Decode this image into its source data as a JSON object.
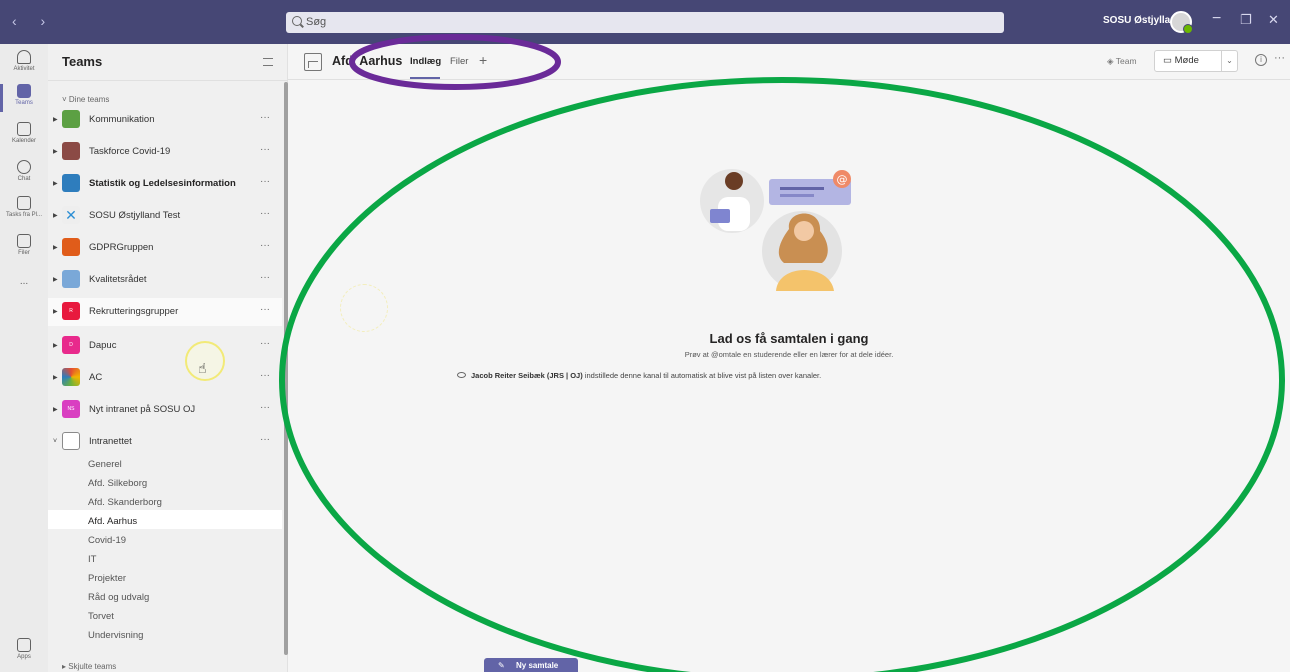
{
  "titlebar": {
    "nav": "‹  ›",
    "search_placeholder": "Søg",
    "org_name": "SOSU Østjylland",
    "minimize": "−",
    "maximize": "❐",
    "close": "✕"
  },
  "rail": [
    {
      "label": "Aktivitet",
      "icon": "bell-icon"
    },
    {
      "label": "Teams",
      "icon": "teams-icon"
    },
    {
      "label": "Kalender",
      "icon": "calendar-icon"
    },
    {
      "label": "Chat",
      "icon": "chat-icon"
    },
    {
      "label": "Tasks fra Pl...",
      "icon": "tasks-icon"
    },
    {
      "label": "Filer",
      "icon": "file-icon"
    },
    {
      "label": "...",
      "icon": "more-icon"
    },
    {
      "label": "Apps",
      "icon": "apps-icon"
    }
  ],
  "panel": {
    "title": "Teams",
    "section": "Dine teams",
    "hidden": "Skjulte teams",
    "teams": [
      {
        "name": "Kommunikation",
        "tile": "",
        "color": "#5ca043"
      },
      {
        "name": "Taskforce Covid-19",
        "tile": "",
        "color": "#8b4a45"
      },
      {
        "name": "Statistik og Ledelsesinformation",
        "tile": "",
        "color": "#2e7dbd"
      },
      {
        "name": "SOSU Østjylland Test",
        "tile": "",
        "color": "#eeeeee"
      },
      {
        "name": "GDPRGruppen",
        "tile": "",
        "color": "#e05c1a"
      },
      {
        "name": "Kvalitetsrådet",
        "tile": "",
        "color": "#7aa8d8"
      },
      {
        "name": "Rekrutteringsgrupper",
        "tile": "R",
        "color": "#e8193e"
      },
      {
        "name": "Dapuc",
        "tile": "D",
        "color": "#e82a8c"
      },
      {
        "name": "AC",
        "tile": "",
        "color": "#6bb33a"
      },
      {
        "name": "Nyt intranet på SOSU OJ",
        "tile": "NS",
        "color": "#d93fc1"
      },
      {
        "name": "Intranettet",
        "tile": "",
        "color": "#ffffff"
      }
    ],
    "more": "···",
    "channels": [
      "Generel",
      "Afd. Silkeborg",
      "Afd. Skanderborg",
      "Afd. Aarhus",
      "Covid-19",
      "IT",
      "Projekter",
      "Råd og udvalg",
      "Torvet",
      "Undervisning"
    ]
  },
  "main": {
    "channel_title": "Afd. Aarhus",
    "tabs": [
      "Indlæg",
      "Filer"
    ],
    "tab_add": "+",
    "team_button": "Team",
    "meet_button": "Møde",
    "meet_caret": "⌄",
    "info": "i",
    "more": "···",
    "empty_title": "Lad os få samtalen i gang",
    "empty_sub": "Prøv at @omtale en studerende eller en lærer for at dele idéer.",
    "system_author": "Jacob Reiter Seibæk (JRS | OJ)",
    "system_text": " indstillede denne kanal til automatisk at blive vist på listen over kanaler.",
    "new_conversation": "Ny samtale"
  },
  "colors": {
    "titlebar": "#464775",
    "accent": "#6264a7",
    "annotation_purple": "#6a2a98",
    "annotation_green": "#0aa745"
  }
}
